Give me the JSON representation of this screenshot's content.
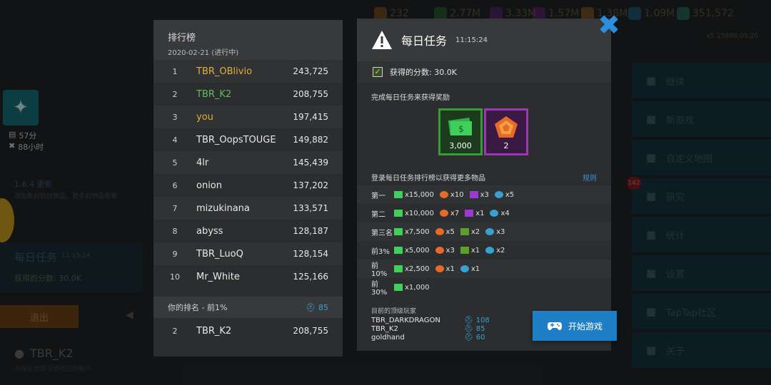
{
  "top_resources": [
    {
      "icon": "hexagon-coin-icon",
      "value": "232",
      "color": "#b56a1c"
    },
    {
      "icon": "green-cash-icon",
      "value": "2.77M",
      "color": "#2a8a3a"
    },
    {
      "icon": "purple-cube-icon",
      "value": "3.33M",
      "color": "#7a2aa0"
    },
    {
      "icon": "purple-stripe-icon",
      "value": "1.57M",
      "color": "#7a2aa0"
    },
    {
      "icon": "orange-badge-icon",
      "value": "1.38M",
      "color": "#c07a1a"
    },
    {
      "icon": "blue-stripe-icon",
      "value": "1.09M",
      "color": "#1a8ab0"
    },
    {
      "icon": "plus-icon",
      "value": "351,572",
      "color": "#2a9a7a"
    }
  ],
  "top_sub": {
    "a": "x5",
    "b": "25898:05:20"
  },
  "side": {
    "stat1": "57分",
    "stat2": "88小时",
    "version": "1.6.4 更新",
    "version_note": "添加新的挑战物品，更多的物品等等",
    "daily_title": "每日任务",
    "daily_time": "11:15:24",
    "daily_score": "获得的分数: 30.0K",
    "exit": "退出",
    "user": "TBR_K2",
    "user_note": "点按此处即可管理您的帐户"
  },
  "menu": [
    {
      "icon": "play-icon",
      "label": "继续"
    },
    {
      "icon": "gamepad-icon",
      "label": "新游戏"
    },
    {
      "icon": "edit-map-icon",
      "label": "自定义地图"
    },
    {
      "icon": "research-icon",
      "label": "研究"
    },
    {
      "icon": "stats-icon",
      "label": "统计"
    },
    {
      "icon": "wrench-icon",
      "label": "设置"
    },
    {
      "icon": "taptap-icon",
      "label": "TapTap社区"
    },
    {
      "icon": "info-icon",
      "label": "关于"
    }
  ],
  "research_badge": "142",
  "leaderboard": {
    "title": "排行榜",
    "subtitle": "2020-02-21 (进行中)",
    "rows": [
      {
        "rank": "1",
        "name": "TBR_OBlivio",
        "score": "243,725",
        "color": "#e0b040"
      },
      {
        "rank": "2",
        "name": "TBR_K2",
        "score": "208,755",
        "color": "#5cc060"
      },
      {
        "rank": "3",
        "name": "you",
        "score": "197,415",
        "color": "#e0b040"
      },
      {
        "rank": "4",
        "name": "TBR_OopsTOUGE",
        "score": "149,882",
        "color": "#e8e8e8"
      },
      {
        "rank": "5",
        "name": "4lr",
        "score": "145,439",
        "color": "#e8e8e8"
      },
      {
        "rank": "6",
        "name": "onion",
        "score": "137,202",
        "color": "#e8e8e8"
      },
      {
        "rank": "7",
        "name": "mizukinana",
        "score": "133,571",
        "color": "#e8e8e8"
      },
      {
        "rank": "8",
        "name": "abyss",
        "score": "128,187",
        "color": "#e8e8e8"
      },
      {
        "rank": "9",
        "name": "TBR_LuoQ",
        "score": "128,154",
        "color": "#e8e8e8"
      },
      {
        "rank": "10",
        "name": "Mr_White",
        "score": "125,166",
        "color": "#e8e8e8"
      }
    ],
    "your_rank_label": "你的排名 - 前1%",
    "your_rank_points": "85",
    "mine": {
      "rank": "2",
      "name": "TBR_K2",
      "score": "208,755"
    }
  },
  "daily": {
    "title": "每日任务",
    "time": "11:15:24",
    "score": "获得的分数: 30.0K",
    "complete_text": "完成每日任务来获得奖励",
    "reward_cash": "3,000",
    "reward_badge": "2",
    "login_text": "登录每日任务排行榜以获得更多物品",
    "rules": "规则",
    "tiers": [
      {
        "label": "第一",
        "items": [
          {
            "icon": "cash-icon",
            "v": "x15,000"
          },
          {
            "icon": "badge-icon",
            "v": "x10"
          },
          {
            "icon": "cube-icon",
            "v": "x3"
          },
          {
            "icon": "token-icon",
            "v": "x5"
          }
        ]
      },
      {
        "label": "第二",
        "items": [
          {
            "icon": "cash-icon",
            "v": "x10,000"
          },
          {
            "icon": "badge-icon",
            "v": "x7"
          },
          {
            "icon": "cube-icon",
            "v": "x1"
          },
          {
            "icon": "token-icon",
            "v": "x4"
          }
        ]
      },
      {
        "label": "第三名",
        "items": [
          {
            "icon": "cash-icon",
            "v": "x7,500"
          },
          {
            "icon": "badge-icon",
            "v": "x5"
          },
          {
            "icon": "green-cube-icon",
            "v": "x2"
          },
          {
            "icon": "token-icon",
            "v": "x3"
          }
        ]
      },
      {
        "label": "前3%",
        "items": [
          {
            "icon": "cash-icon",
            "v": "x5,000"
          },
          {
            "icon": "badge-icon",
            "v": "x3"
          },
          {
            "icon": "green-cube-icon",
            "v": "x1"
          },
          {
            "icon": "token-icon",
            "v": "x2"
          }
        ]
      },
      {
        "label": "前10%",
        "items": [
          {
            "icon": "cash-icon",
            "v": "x2,500"
          },
          {
            "icon": "badge-icon",
            "v": "x1"
          },
          {
            "icon": "token-icon",
            "v": "x1"
          }
        ]
      },
      {
        "label": "前30%",
        "items": [
          {
            "icon": "cash-icon",
            "v": "x1,000"
          }
        ]
      }
    ],
    "top_players_label": "目前的顶级玩家",
    "top_players": [
      {
        "name": "TBR_DARKDRAGON",
        "score": "108"
      },
      {
        "name": "TBR_K2",
        "score": "85"
      },
      {
        "name": "goldhand",
        "score": "60"
      }
    ],
    "start": "开始游戏"
  }
}
